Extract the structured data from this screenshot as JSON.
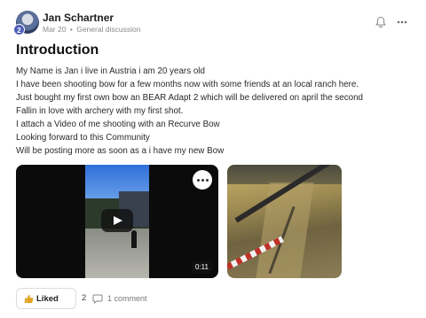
{
  "post": {
    "author": "Jan Schartner",
    "avatar_badge": "2",
    "date": "Mar 20",
    "separator": "•",
    "category": "General discussion",
    "title": "Introduction",
    "body_lines": [
      "My Name is Jan i live in Austria i am 20 years old",
      "I have been shooting bow for a few months now with some friends at an local ranch here.",
      "Just bought my first own bow an BEAR Adapt 2 which will be delivered on april the second",
      "Fallin in love with archery with my first shot.",
      "I attach a Video of me shooting with an Recurve Bow",
      "Looking forward to this Community",
      "Will be posting more as soon as a i have my new Bow"
    ]
  },
  "media": {
    "video_duration": "0:11",
    "video_more_icon": "more-dots-icon",
    "play_icon": "play-icon"
  },
  "actions": {
    "like_label": "Liked",
    "like_count": "2",
    "comment_label": "1 comment"
  },
  "icons": {
    "bell": "bell-icon",
    "more": "more-horizontal-icon",
    "thumb": "thumbs-up-icon",
    "comment": "comment-icon"
  },
  "colors": {
    "badge": "#4e5fb8",
    "text": "#2a2a2a",
    "meta": "#8a8a8a"
  }
}
